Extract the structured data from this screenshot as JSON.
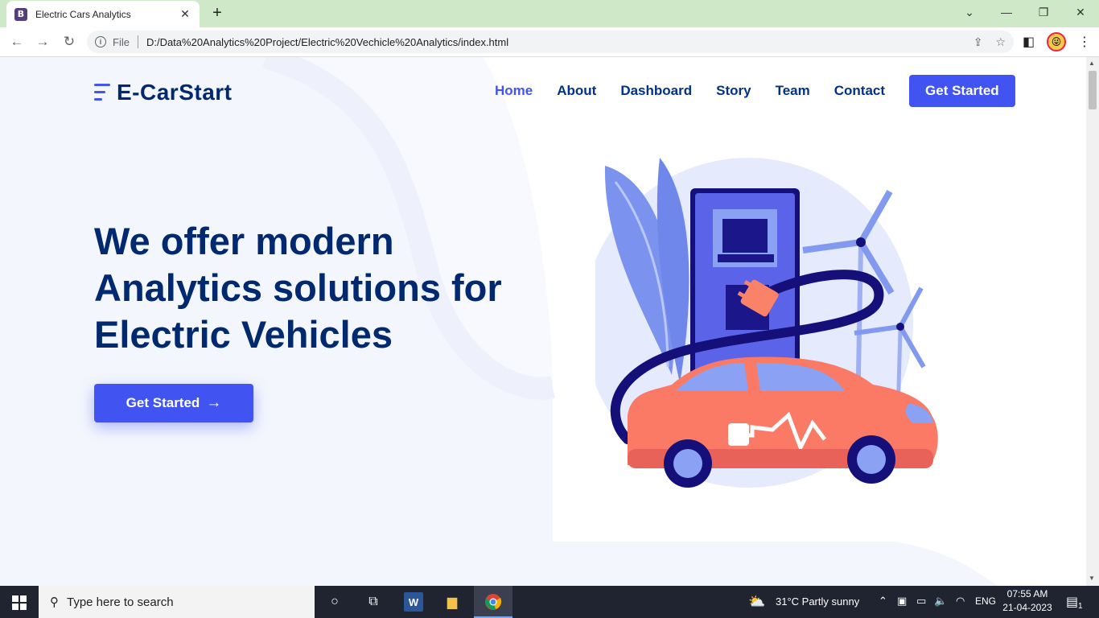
{
  "browser": {
    "tab_title": "Electric Cars Analytics",
    "tab_favicon": "B",
    "file_label": "File",
    "url": "D:/Data%20Analytics%20Project/Electric%20Vechicle%20Analytics/index.html"
  },
  "site": {
    "logo_text": "E-CarStart",
    "nav": [
      "Home",
      "About",
      "Dashboard",
      "Story",
      "Team",
      "Contact"
    ],
    "active_nav": "Home",
    "cta_label": "Get Started",
    "hero_title": "We offer modern Analytics solutions for Electric Vehicles",
    "hero_button": "Get Started",
    "hero_button_arrow": "→"
  },
  "taskbar": {
    "search_placeholder": "Type here to search",
    "weather": "31°C  Partly sunny",
    "language": "ENG",
    "time": "07:55 AM",
    "date": "21-04-2023",
    "notification_count": "1"
  },
  "colors": {
    "accent": "#4154f1",
    "heading": "#012970",
    "nav": "#013289",
    "hero_bg": "#f4f6fd"
  }
}
